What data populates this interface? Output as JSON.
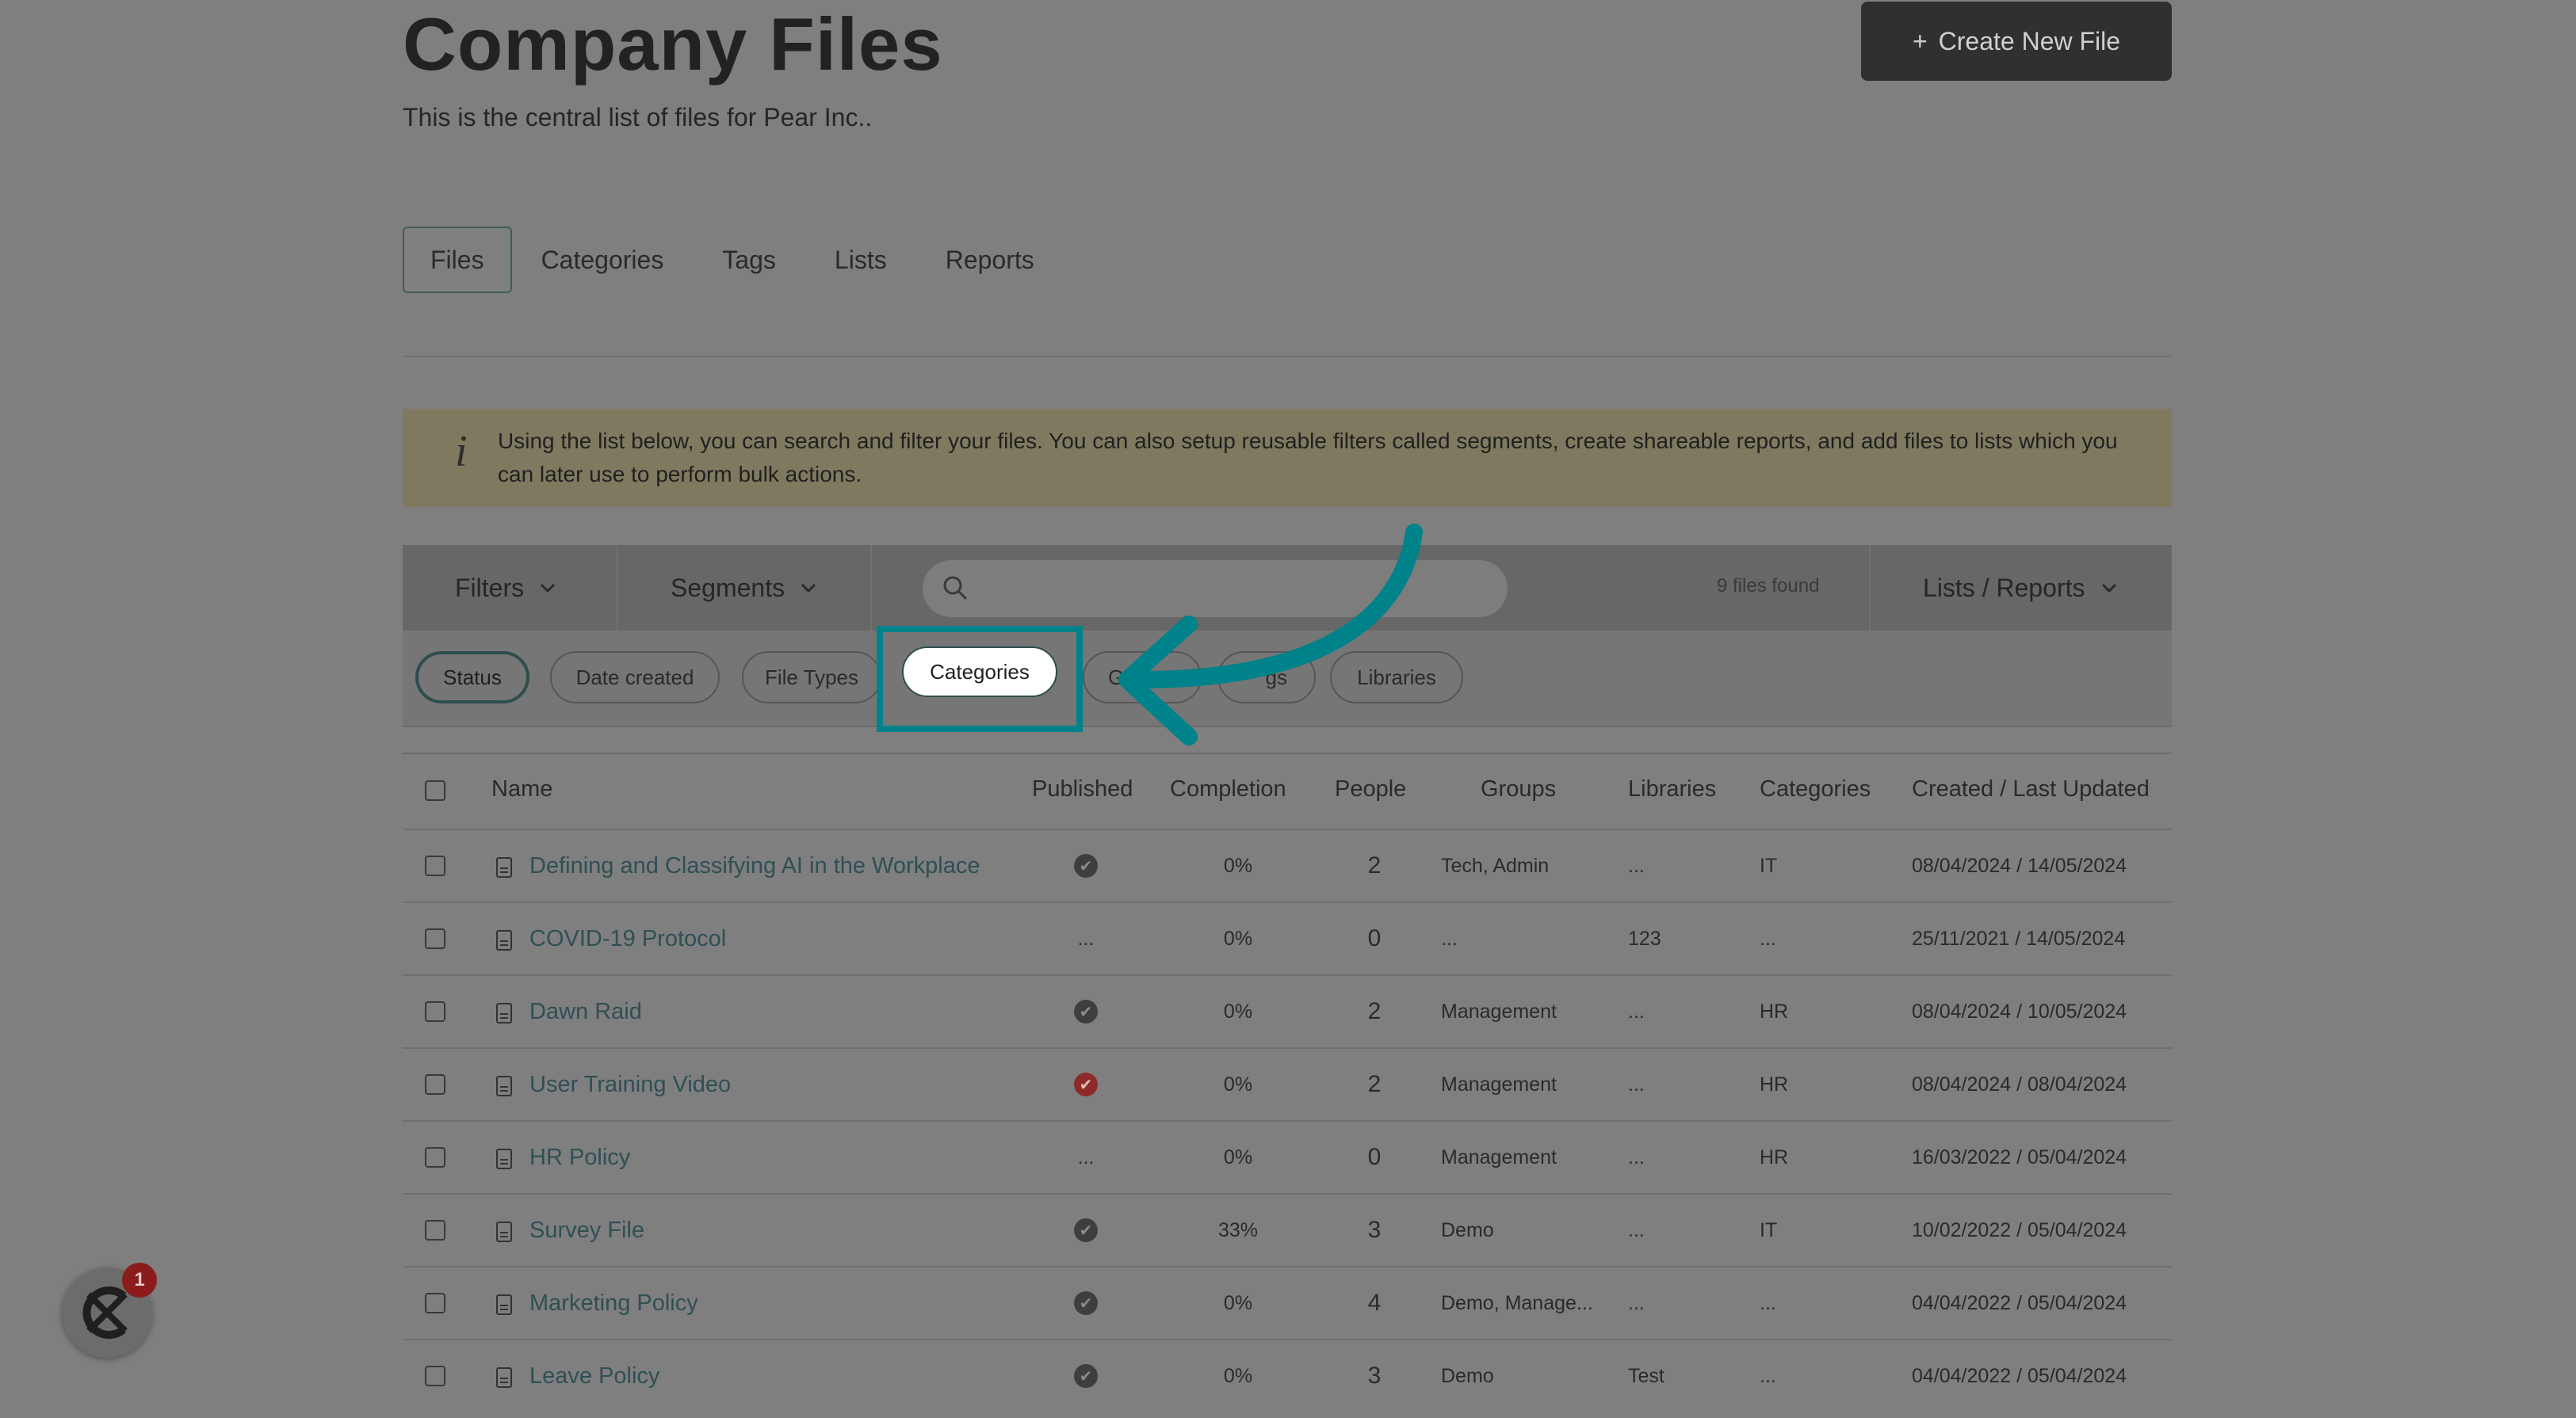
{
  "header": {
    "title": "Company Files",
    "subtitle": "This is the central list of files for Pear Inc..",
    "create_button": "Create New File",
    "create_plus": "+"
  },
  "tabs": [
    {
      "label": "Files",
      "active": true
    },
    {
      "label": "Categories",
      "active": false
    },
    {
      "label": "Tags",
      "active": false
    },
    {
      "label": "Lists",
      "active": false
    },
    {
      "label": "Reports",
      "active": false
    }
  ],
  "info": {
    "icon": "i",
    "text": "Using the list below, you can search and filter your files. You can also setup reusable filters called segments, create shareable reports, and add files to lists which you can later use to perform bulk actions."
  },
  "toolbar": {
    "filters": "Filters",
    "segments": "Segments",
    "search_placeholder": "",
    "files_found": "9 files found",
    "lists_reports": "Lists / Reports"
  },
  "chips": [
    {
      "label": "Status",
      "active": true
    },
    {
      "label": "Date created",
      "active": false
    },
    {
      "label": "File Types",
      "active": false
    },
    {
      "label": "Categories",
      "active": false,
      "highlighted": true
    },
    {
      "label": "G",
      "active": false
    },
    {
      "label": "gs",
      "active": false
    },
    {
      "label": "Libraries",
      "active": false
    }
  ],
  "table": {
    "headers": [
      "Name",
      "Published",
      "Completion",
      "People",
      "Groups",
      "Libraries",
      "Categories",
      "Created / Last Updated"
    ],
    "rows": [
      {
        "name": "Defining and Classifying AI in the Workplace",
        "published": "check",
        "completion": "0%",
        "people": "2",
        "groups": "Tech, Admin",
        "libraries": "...",
        "categories": "IT",
        "dates": "08/04/2024 / 14/05/2024"
      },
      {
        "name": "COVID-19 Protocol",
        "published": "...",
        "completion": "0%",
        "people": "0",
        "groups": "...",
        "libraries": "123",
        "categories": "...",
        "dates": "25/11/2021 / 14/05/2024"
      },
      {
        "name": "Dawn Raid",
        "published": "check",
        "completion": "0%",
        "people": "2",
        "groups": "Management",
        "libraries": "...",
        "categories": "HR",
        "dates": "08/04/2024 / 10/05/2024"
      },
      {
        "name": "User Training Video",
        "published": "check-red",
        "completion": "0%",
        "people": "2",
        "groups": "Management",
        "libraries": "...",
        "categories": "HR",
        "dates": "08/04/2024 / 08/04/2024"
      },
      {
        "name": "HR Policy",
        "published": "...",
        "completion": "0%",
        "people": "0",
        "groups": "Management",
        "libraries": "...",
        "categories": "HR",
        "dates": "16/03/2022 / 05/04/2024"
      },
      {
        "name": "Survey File",
        "published": "check",
        "completion": "33%",
        "people": "3",
        "groups": "Demo",
        "libraries": "...",
        "categories": "IT",
        "dates": "10/02/2022 / 05/04/2024"
      },
      {
        "name": "Marketing Policy",
        "published": "check",
        "completion": "0%",
        "people": "4",
        "groups": "Demo, Manage...",
        "libraries": "...",
        "categories": "...",
        "dates": "04/04/2022 / 05/04/2024"
      },
      {
        "name": "Leave Policy",
        "published": "check",
        "completion": "0%",
        "people": "3",
        "groups": "Demo",
        "libraries": "Test",
        "categories": "...",
        "dates": "04/04/2022 / 05/04/2024"
      }
    ]
  },
  "fab": {
    "badge": "1",
    "icon": "app-logo-icon"
  },
  "colors": {
    "highlight": "#00828a",
    "overlay": "#7f7f7f"
  }
}
